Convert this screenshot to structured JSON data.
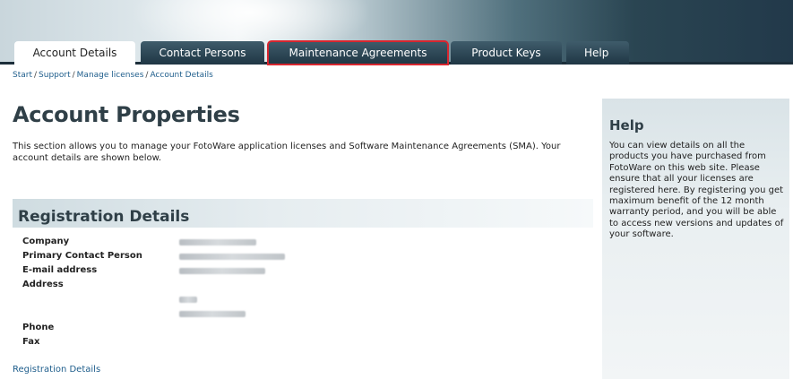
{
  "tabs": [
    {
      "label": "Account Details",
      "state": "active"
    },
    {
      "label": "Contact Persons",
      "state": "inactive"
    },
    {
      "label": "Maintenance Agreements",
      "state": "highlighted"
    },
    {
      "label": "Product Keys",
      "state": "inactive"
    },
    {
      "label": "Help",
      "state": "inactive"
    }
  ],
  "breadcrumb": [
    "Start",
    "Support",
    "Manage licenses",
    "Account Details"
  ],
  "breadcrumb_separator": "/",
  "page_title": "Account Properties",
  "intro": "This section allows you to manage your FotoWare application licenses and Software Maintenance Agreements (SMA). Your account details are shown below.",
  "registration": {
    "title": "Registration Details",
    "labels": {
      "company": "Company",
      "primary_contact": "Primary Contact Person",
      "email": "E-mail address",
      "address": "Address",
      "phone": "Phone",
      "fax": "Fax"
    }
  },
  "footer_link": "Registration Details",
  "help": {
    "title": "Help",
    "text": "You can view details on all the products you have purchased from FotoWare on this web site. Please ensure that all your licenses are registered here. By registering you get maximum benefit of the 12 month warranty period, and you will be able to access new versions and updates of your software."
  },
  "colors": {
    "highlight_outline": "#d8262f",
    "link": "#1f5e8c",
    "heading": "#2f3f47",
    "tab_dark": "#1f3644"
  }
}
